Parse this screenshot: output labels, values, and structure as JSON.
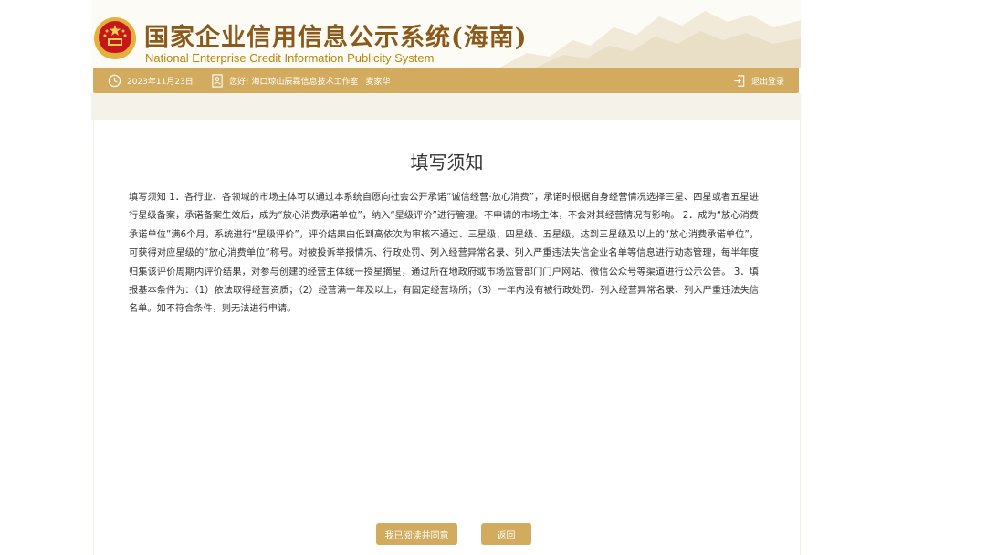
{
  "header": {
    "title_cn": "国家企业信用信息公示系统(海南)",
    "title_en": "National Enterprise Credit Information Publicity System",
    "emblem_icon": "national-emblem-icon"
  },
  "topbar": {
    "date": "2023年11月23日",
    "greeting": "您好! 海口琼山辰霖信息技术工作室",
    "user_name": "麦家华",
    "logout_label": "退出登录",
    "icons": [
      "clock-icon",
      "user-card-icon",
      "logout-icon"
    ],
    "bg_color": "#d2ab5f"
  },
  "notice": {
    "title": "填写须知",
    "body": "填写须知 1．各行业、各领域的市场主体可以通过本系统自愿向社会公开承诺“诚信经营·放心消费”，承诺时根据自身经营情况选择三星、四星或者五星进行星级备案，承诺备案生效后，成为“放心消费承诺单位”，纳入“星级评价”进行管理。不申请的市场主体，不会对其经营情况有影响。 2．成为“放心消费承诺单位”满6个月，系统进行“星级评价”，评价结果由低到高依次为审核不通过、三星级、四星级、五星级，达到三星级及以上的“放心消费承诺单位”，可获得对应星级的“放心消费单位”称号。对被投诉举报情况、行政处罚、列入经营异常名录、列入严重违法失信企业名单等信息进行动态管理，每半年度归集该评价周期内评价结果，对参与创建的经营主体统一授星摘星，通过所在地政府或市场监管部门门户网站、微信公众号等渠道进行公示公告。 3．填报基本条件为：（1）依法取得经营资质；（2）经营满一年及以上，有固定经营场所；（3）一年内没有被行政处罚、列入经营异常名录、列入严重违法失信名单。如不符合条件，则无法进行申请。"
  },
  "actions": {
    "agree_label": "我已阅读并同意",
    "back_label": "返回"
  },
  "colors": {
    "accent": "#d2ab5f",
    "title_brown": "#8b5a1a",
    "subtitle_gold": "#b8860b"
  }
}
